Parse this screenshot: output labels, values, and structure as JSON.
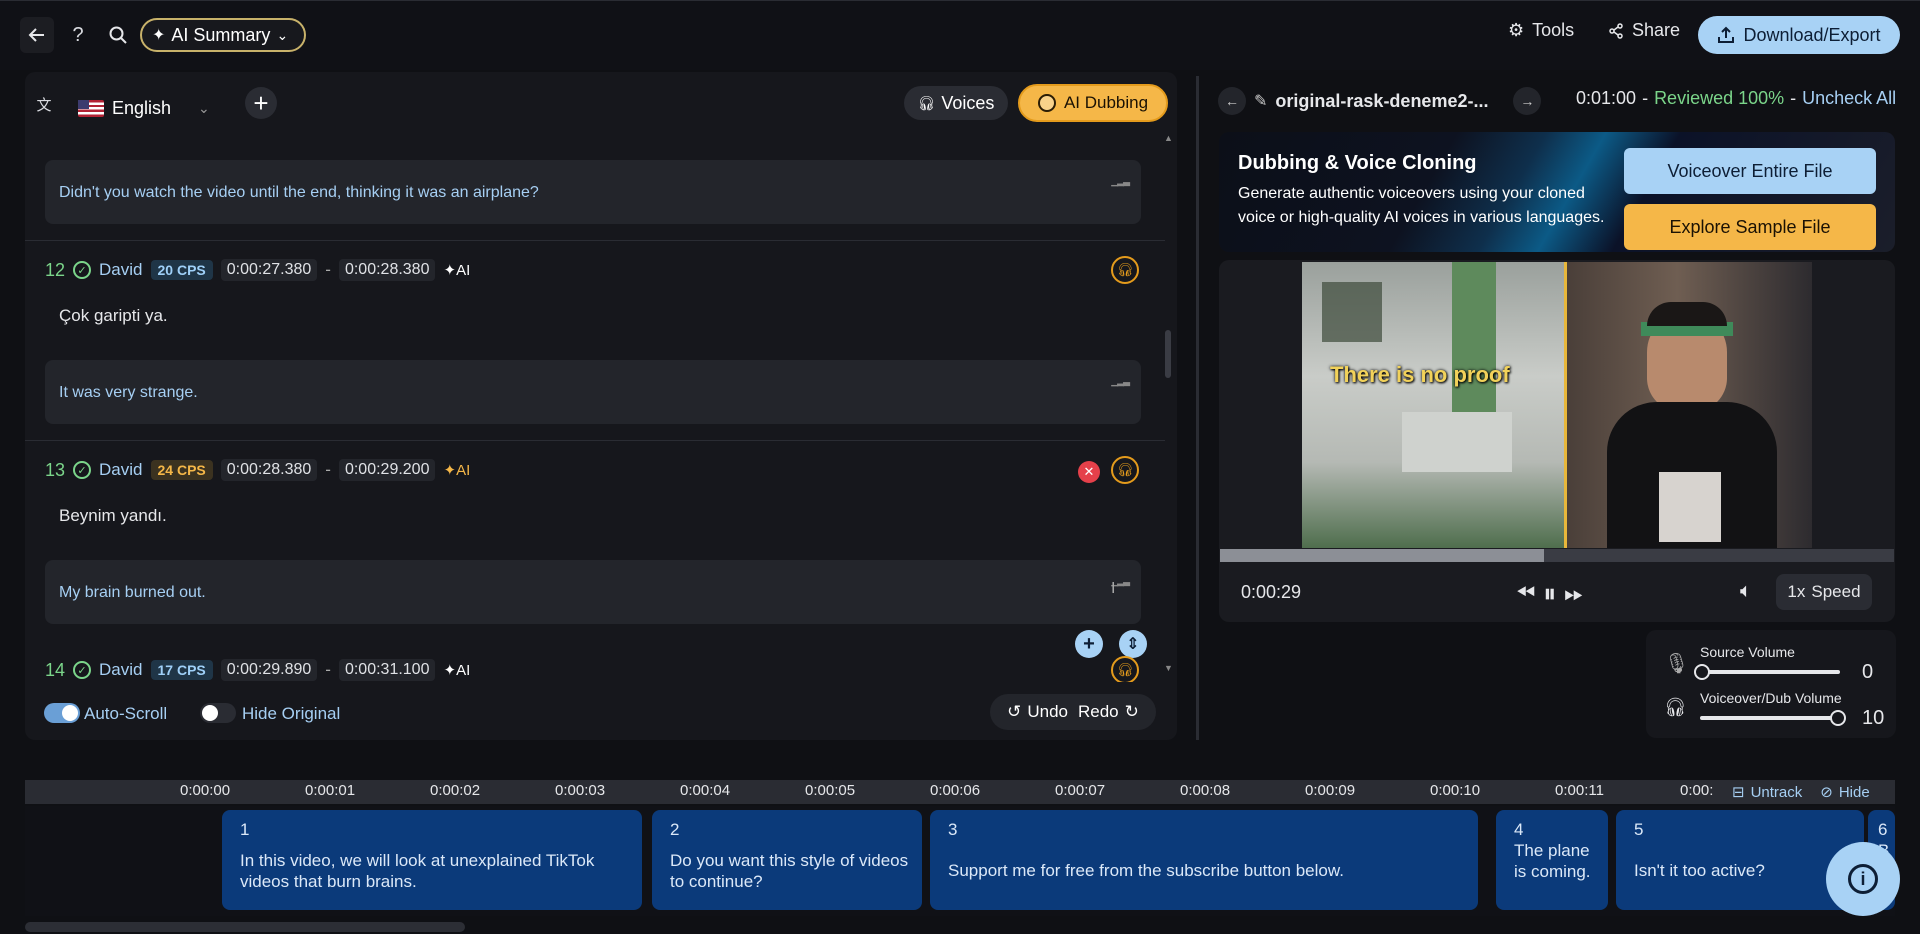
{
  "header": {
    "ai_summary_label": "AI Summary",
    "tools_label": "Tools",
    "share_label": "Share",
    "download_label": "Download/Export"
  },
  "editor": {
    "language": "English",
    "voices_label": "Voices",
    "ai_dubbing_label": "AI Dubbing",
    "segments": [
      {
        "number": "",
        "speaker": "",
        "translation": "Didn't you watch the video until the end, thinking it was an airplane?"
      },
      {
        "number": "12",
        "speaker": "David",
        "cps": "20 CPS",
        "start": "0:00:27.380",
        "end": "0:00:28.380",
        "ai_tag": "AI",
        "original": "Çok garipti ya.",
        "translation": "It was very strange."
      },
      {
        "number": "13",
        "speaker": "David",
        "cps": "24 CPS",
        "start": "0:00:28.380",
        "end": "0:00:29.200",
        "ai_tag": "AI",
        "original": "Beynim yandı.",
        "translation": "My brain burned out."
      },
      {
        "number": "14",
        "speaker": "David",
        "cps": "17 CPS",
        "start": "0:00:29.890",
        "end": "0:00:31.100",
        "ai_tag": "AI"
      }
    ],
    "auto_scroll_label": "Auto-Scroll",
    "auto_scroll_on": true,
    "hide_original_label": "Hide Original",
    "hide_original_on": false,
    "undo_label": "Undo",
    "redo_label": "Redo"
  },
  "player": {
    "file_name": "original-rask-deneme2-...",
    "duration": "0:01:00",
    "reviewed": "Reviewed 100%",
    "uncheck_all": "Uncheck All",
    "promo_title": "Dubbing & Voice Cloning",
    "promo_desc": "Generate authentic voiceovers using your cloned voice or high-quality AI voices in various languages.",
    "voiceover_label": "Voiceover Entire File",
    "sample_label": "Explore Sample File",
    "caption": "There is no proof",
    "current_time": "0:00:29",
    "progress": 0.48,
    "speed_value": "1x",
    "speed_label": "Speed",
    "source_volume_label": "Source Volume",
    "source_volume": "0",
    "dub_volume_label": "Voiceover/Dub Volume",
    "dub_volume": "10"
  },
  "timeline": {
    "ticks": [
      "0:00:00",
      "0:00:01",
      "0:00:02",
      "0:00:03",
      "0:00:04",
      "0:00:05",
      "0:00:06",
      "0:00:07",
      "0:00:08",
      "0:00:09",
      "0:00:10",
      "0:00:11",
      "0:00:"
    ],
    "untrack_label": "Untrack",
    "hide_label": "Hide",
    "clips": [
      {
        "number": "1",
        "text": "In this video, we will look at unexplained TikTok videos that burn brains."
      },
      {
        "number": "2",
        "text": "Do you want this style of videos to continue?"
      },
      {
        "number": "3",
        "text": "Support me for free from the subscribe button below."
      },
      {
        "number": "4",
        "text": "The plane is coming."
      },
      {
        "number": "5",
        "text": "Isn't it too active?"
      },
      {
        "number": "6",
        "text": "B"
      }
    ]
  },
  "colors": {
    "accent_blue": "#a8d2f5",
    "accent_orange": "#f5b748",
    "reviewed_green": "#7bd58a",
    "clip_blue": "#0b3a7a"
  }
}
